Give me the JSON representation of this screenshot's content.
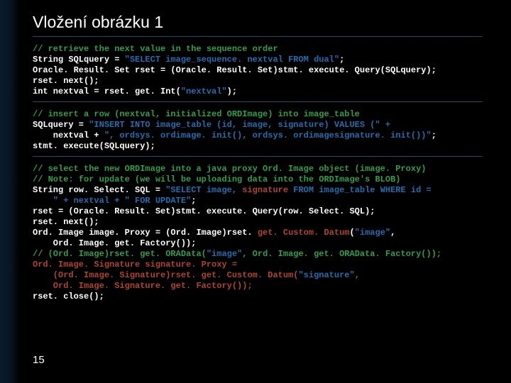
{
  "title": "Vložení obrázku 1",
  "page_number": "15",
  "block1": {
    "c1": "// retrieve the next value in the sequence order",
    "l1a": "String SQLquery = ",
    "l1b": "\"SELECT image_sequence. nextval FROM dual\"",
    "l1c": ";",
    "l2": "Oracle. Result. Set rset = (Oracle. Result. Set)stmt. execute. Query(SQLquery);",
    "l3": "rset. next();",
    "l4a": "int nextval = rset. get. Int(",
    "l4b": "\"nextval\"",
    "l4c": ");"
  },
  "block2": {
    "c1": "// insert a row (nextval, initialized ORDImage) into image_table",
    "l1a": "SQLquery = ",
    "l1b": "\"INSERT INTO image_table (id, image, signature) VALUES (\" +",
    "l2a": "    nextval + ",
    "l2b": "\", ordsys. ordimage. init(), ordsys. ordimagesignature. init())\"",
    "l2c": ";",
    "l3": "stmt. execute(SQLquery);"
  },
  "block3": {
    "c1": "// select the new ORDImage into a java proxy Ord. Image object (image. Proxy)",
    "c2": "// Note: for update (we will be uploading data into the ORDImage's BLOB)",
    "l1a": "String row. Select. SQL = ",
    "l1b": "\"SELECT image, ",
    "l1h": "signature",
    "l1c": " FROM image_table WHERE id =",
    "l2a": "    \" + nextval + ",
    "l2b": "\" FOR UPDATE\"",
    "l2c": ";",
    "l3": "rset = (Oracle. Result. Set)stmt. execute. Query(row. Select. SQL);",
    "l4": "rset. next();",
    "l5a": "Ord. Image image. Proxy = (Ord. Image)rset. ",
    "l5h": "get. Custom. Datum",
    "l5b": "(",
    "l5c": "\"image\"",
    "l5d": ",",
    "l6": "    Ord. Image. get. Factory());",
    "c3a": "// (Ord. Image)rset. get. ORAData(",
    "c3b": "\"image\"",
    "c3c": ", Ord. Image. get. ORAData. Factory());",
    "l7": "Ord. Image. Signature signature. Proxy =",
    "l8a": "    (Ord. Image. Signature)rset. get. Custom. Datum(",
    "l8b": "\"signature\"",
    "l8c": ",",
    "l9": "    Ord. Image. Signature. get. Factory());",
    "l10": "rset. close();"
  }
}
